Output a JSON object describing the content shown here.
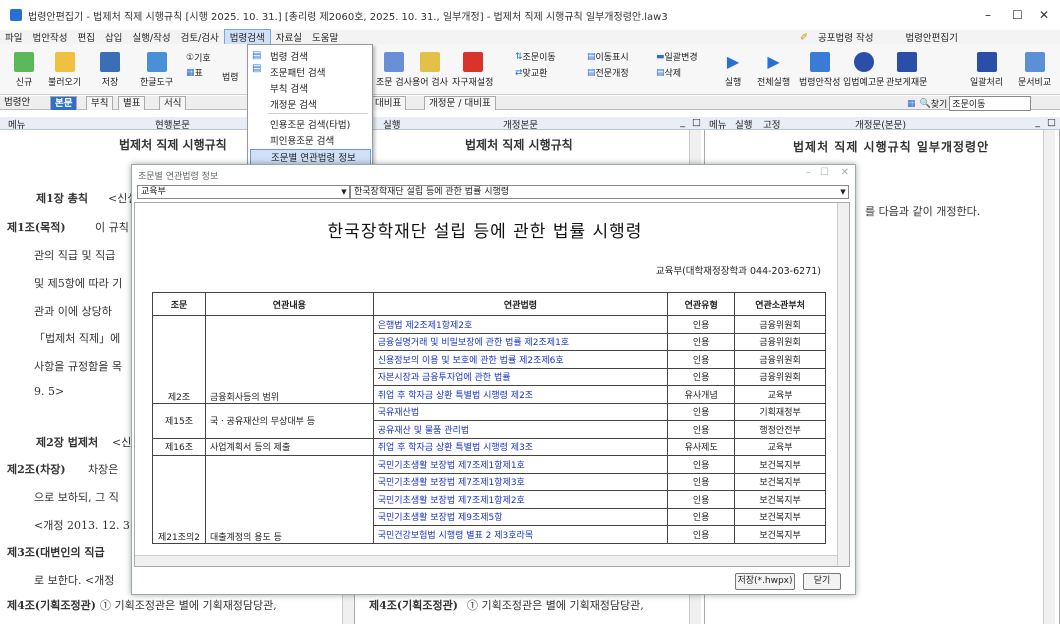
{
  "window": {
    "title": "법령안편집기 - 법제처 직제 시행규칙 [시행 2025. 10. 31.] [총리령 제2060호, 2025. 10. 31., 일부개정] - 법제처 직제 시행규칙 일부개정령안.law3"
  },
  "menu": [
    "파일",
    "법안작성",
    "편집",
    "삽입",
    "실행/작성",
    "검토/검사",
    "법령검색",
    "자료실",
    "도움말"
  ],
  "topright": {
    "draft": "공포법령 작성",
    "editor": "법령안편집기"
  },
  "ribbon": {
    "new": "신규",
    "load": "불러오기",
    "save": "저장",
    "hangul": "한글도구",
    "sym": "기호",
    "table": "표",
    "law": "법령",
    "check": "조문 검사",
    "term": "용어 검사",
    "autoset": "자구재설정",
    "jomun_move": "조문이동",
    "move_show": "이동표시",
    "batch_change": "일괄변경",
    "matgyo": "맞교환",
    "full_revise": "전문개정",
    "delete": "삭제",
    "run": "실행",
    "run_all": "전체실행",
    "draft": "법령안작성",
    "legislation": "입법예고문",
    "gazette": "관보게재문",
    "batch_proc": "일괄처리",
    "doc_compare": "문서비교",
    "find_label": "찾기",
    "find_value": "조문이동"
  },
  "tabs": {
    "law": "법령안",
    "body": "본문",
    "appendix": "부칙",
    "annex": "별표",
    "form": "서식",
    "compare": "령 / 대비표",
    "revised_compare": "개정문 / 대비표"
  },
  "panes": {
    "menu": "메뉴",
    "current": "현행본문",
    "run": "실행",
    "revised": "개정본문",
    "fix": "고정",
    "revised_text": "개정문(본문)"
  },
  "left": {
    "title": "법제처 직제 시행규칙",
    "ch1": "제1장 총칙",
    "ch1_note": "<신설",
    "a1": "제1조(목적)",
    "a1_text": "이 규칙",
    "l1": "관의 직급 및 직급",
    "l2": "및 제5항에 따라 기",
    "l3": "관과 이에 상당하",
    "l4": "「법제처 직제」에",
    "l5": "사항을 규정함을 목",
    "l6": "9. 5>",
    "ch2": "제2장 법제처",
    "ch2_note": "<신",
    "a2": "제2조(차장)",
    "a2_text": "차장은",
    "l7": "으로 보하되, 그 직",
    "l8": "<개정 2013. 12. 31",
    "a3": "제3조(대변인의 직급",
    "l9": "로 보한다. <개정",
    "a4": "제4조(기획조정관)",
    "a4_text": "① 기획조정관은 별에 기획재정담당관,"
  },
  "mid": {
    "title": "법제처 직제 시행규칙",
    "a4": "제4조(기획조정관)",
    "a4_text": "① 기획조정관은 별에 기획재정담당관,"
  },
  "right": {
    "title": "법제처 직제 시행규칙 일부개정령안",
    "line": "를 다음과 같이 개정한다."
  },
  "dropdown": {
    "items": [
      "법령 검색",
      "조문패턴 검색",
      "부칙 검색",
      "개정문 검색",
      "인용조문 검색(타법)",
      "피인용조문 검색",
      "조문별 연관법령 정보"
    ]
  },
  "dialog": {
    "title": "조문별 연관법령 정보",
    "ministry": "교육부",
    "law": "한국장학재단 설립 등에 관한 법률 시행령",
    "heading": "한국장학재단 설립 등에 관한 법률 시행령",
    "dept": "교육부(대학재정장학과 044-203-6271)",
    "headers": [
      "조문",
      "연관내용",
      "연관법령",
      "연관유형",
      "연관소관부처"
    ],
    "save": "저장(*.hwpx)",
    "close": "닫기",
    "rows": [
      {
        "art": "",
        "content": "",
        "law": "은행법 제2조제1항제2호",
        "type": "인용",
        "ministry": "금융위원회"
      },
      {
        "art": "",
        "content": "",
        "law": "금융실명거래 및 비밀보장에 관한 법률 제2조제1호",
        "type": "인용",
        "ministry": "금융위원회"
      },
      {
        "art": "제2조",
        "content": "금융회사등의 범위",
        "law": "신용정보의 이용 및 보호에 관한 법률 제2조제6호",
        "type": "인용",
        "ministry": "금융위원회"
      },
      {
        "art": "",
        "content": "",
        "law": "자본시장과 금융투자업에 관한 법률",
        "type": "인용",
        "ministry": "금융위원회"
      },
      {
        "art": "",
        "content": "",
        "law": "취업 후 학자금 상환 특별법 시행령 제2조",
        "type": "유사개념",
        "ministry": "교육부"
      },
      {
        "art": "제15조",
        "content": "국ㆍ공유재산의 무상대부 등",
        "law": "국유재산법",
        "type": "인용",
        "ministry": "기획재정부"
      },
      {
        "art": "",
        "content": "",
        "law": "공유재산 및 물품 관리법",
        "type": "인용",
        "ministry": "행정안전부"
      },
      {
        "art": "제16조",
        "content": "사업계획서 등의 제출",
        "law": "취업 후 학자금 상환 특별법 시행령 제3조",
        "type": "유사제도",
        "ministry": "교육부"
      },
      {
        "art": "",
        "content": "",
        "law": "국민기초생활 보장법 제7조제1항제1호",
        "type": "인용",
        "ministry": "보건복지부"
      },
      {
        "art": "",
        "content": "",
        "law": "국민기초생활 보장법 제7조제1항제3호",
        "type": "인용",
        "ministry": "보건복지부"
      },
      {
        "art": "",
        "content": "",
        "law": "국민기초생활 보장법 제7조제1항제2호",
        "type": "인용",
        "ministry": "보건복지부"
      },
      {
        "art": "",
        "content": "",
        "law": "국민기초생활 보장법 제9조제5항",
        "type": "인용",
        "ministry": "보건복지부"
      },
      {
        "art": "제21조의2",
        "content": "대출계정의 용도 등",
        "law": "국민건강보험법 시행령 별표 2 제3호라목",
        "type": "인용",
        "ministry": "보건복지부"
      }
    ]
  }
}
